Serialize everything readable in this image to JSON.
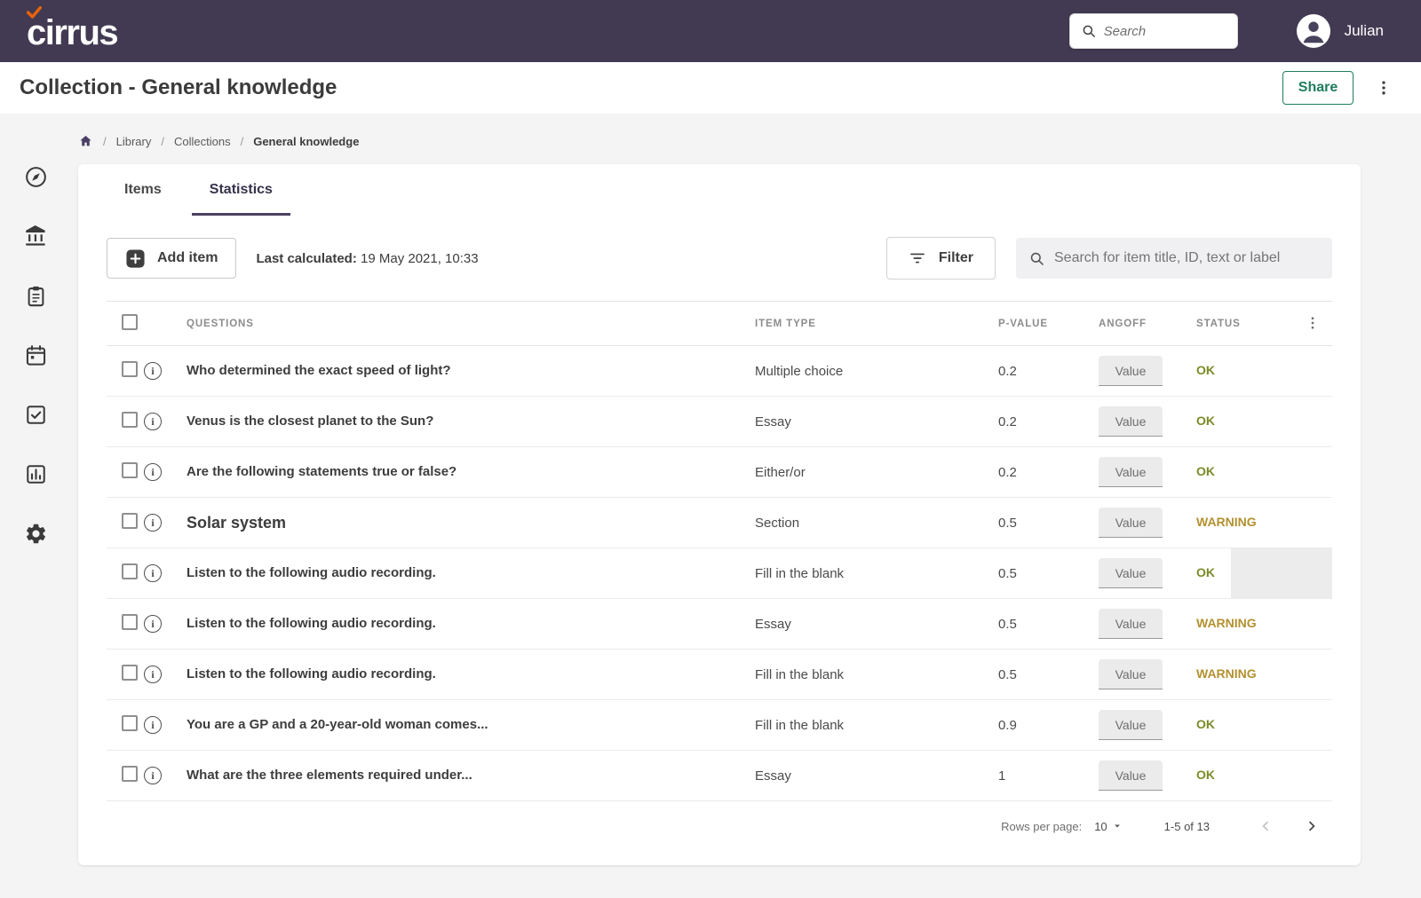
{
  "topbar": {
    "logo_text": "cirrus",
    "search_placeholder": "Search",
    "user_name": "Julian"
  },
  "page_header": {
    "title": "Collection - General knowledge",
    "share_label": "Share"
  },
  "breadcrumb": {
    "separator": "/",
    "items": [
      "Library",
      "Collections",
      "General knowledge"
    ]
  },
  "sidebar": {
    "icons": [
      "compass-icon",
      "bank-icon",
      "clipboard-icon",
      "calendar-icon",
      "task-check-icon",
      "bar-chart-icon",
      "gear-icon"
    ]
  },
  "tabs": [
    {
      "label": "Items",
      "active": false
    },
    {
      "label": "Statistics",
      "active": true
    }
  ],
  "toolbar": {
    "add_item_label": "Add item",
    "last_calculated_label": "Last calculated:",
    "last_calculated_value": "19 May 2021, 10:33",
    "filter_label": "Filter",
    "search_placeholder": "Search for item title, ID, text or label"
  },
  "table": {
    "columns": {
      "questions": "QUESTIONS",
      "item_type": "ITEM TYPE",
      "p_value": "P-VALUE",
      "angoff": "ANGOFF",
      "status": "STATUS"
    },
    "angoff_placeholder": "Value",
    "info_glyph": "i",
    "rows": [
      {
        "question": "Who determined the exact speed of light?",
        "item_type": "Multiple choice",
        "p_value": "0.2",
        "status": "OK",
        "section": false,
        "end_highlight": false
      },
      {
        "question": "Venus is the closest planet to the Sun?",
        "item_type": "Essay",
        "p_value": "0.2",
        "status": "OK",
        "section": false,
        "end_highlight": false
      },
      {
        "question": "Are the following statements true or false?",
        "item_type": "Either/or",
        "p_value": "0.2",
        "status": "OK",
        "section": false,
        "end_highlight": false
      },
      {
        "question": "Solar system",
        "item_type": "Section",
        "p_value": "0.5",
        "status": "WARNING",
        "section": true,
        "end_highlight": false
      },
      {
        "question": "Listen to the following audio recording.",
        "item_type": "Fill in the blank",
        "p_value": "0.5",
        "status": "OK",
        "section": false,
        "end_highlight": true
      },
      {
        "question": "Listen to the following audio recording.",
        "item_type": "Essay",
        "p_value": "0.5",
        "status": "WARNING",
        "section": false,
        "end_highlight": false
      },
      {
        "question": "Listen to the following audio recording.",
        "item_type": "Fill in the blank",
        "p_value": "0.5",
        "status": "WARNING",
        "section": false,
        "end_highlight": false
      },
      {
        "question": "You are a GP and a 20-year-old woman comes...",
        "item_type": "Fill in the blank",
        "p_value": "0.9",
        "status": "OK",
        "section": false,
        "end_highlight": false
      },
      {
        "question": "What are the three elements required under...",
        "item_type": "Essay",
        "p_value": "1",
        "status": "OK",
        "section": false,
        "end_highlight": false
      }
    ]
  },
  "pagination": {
    "rows_per_page_label": "Rows per page:",
    "rows_per_page_value": "10",
    "range_label": "1-5 of 13"
  },
  "colors": {
    "topbar_bg": "#423a52",
    "logo_check_orange": "#e8630c",
    "share_green": "#1f7d5f",
    "tab_underline": "#4a4160",
    "status_ok": "#7c8a27",
    "status_warning": "#b3912f"
  }
}
